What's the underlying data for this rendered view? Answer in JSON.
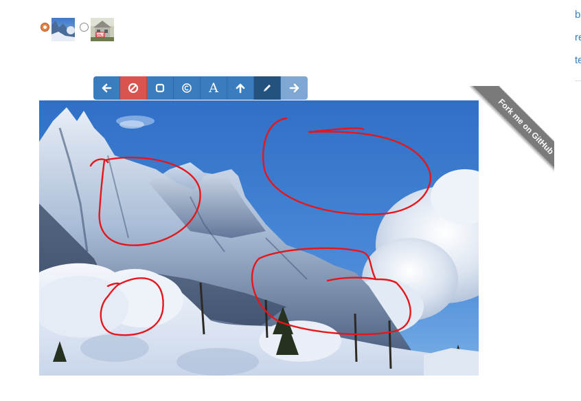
{
  "image_picker": {
    "options": [
      {
        "name": "mountain",
        "selected": true,
        "icon": "mountain-photo"
      },
      {
        "name": "house",
        "selected": false,
        "icon": "house-photo",
        "sign_text": "SOLD"
      }
    ]
  },
  "toolbar": {
    "buttons": [
      {
        "icon": "arrow-left-icon",
        "state": "normal"
      },
      {
        "icon": "clear-icon",
        "state": "danger"
      },
      {
        "icon": "rectangle-icon",
        "state": "normal"
      },
      {
        "icon": "copyright-icon",
        "state": "normal"
      },
      {
        "icon": "text-icon",
        "label": "A",
        "state": "normal"
      },
      {
        "icon": "arrow-up-icon",
        "state": "normal"
      },
      {
        "icon": "pencil-icon",
        "state": "active"
      },
      {
        "icon": "arrow-right-icon",
        "state": "disabled"
      }
    ],
    "colors": {
      "primary": "#3a7dbf",
      "danger": "#d9534f",
      "active": "#24527f",
      "disabled": "#7ea8d3"
    }
  },
  "canvas": {
    "annotation_color": "#e5161c",
    "annotations": [
      "freehand-circle",
      "freehand-circle",
      "freehand-circle",
      "freehand-circle"
    ]
  },
  "ribbon": {
    "text": "Fork me on GitHub"
  },
  "sidebar_links": [
    "b",
    "re",
    "te"
  ]
}
